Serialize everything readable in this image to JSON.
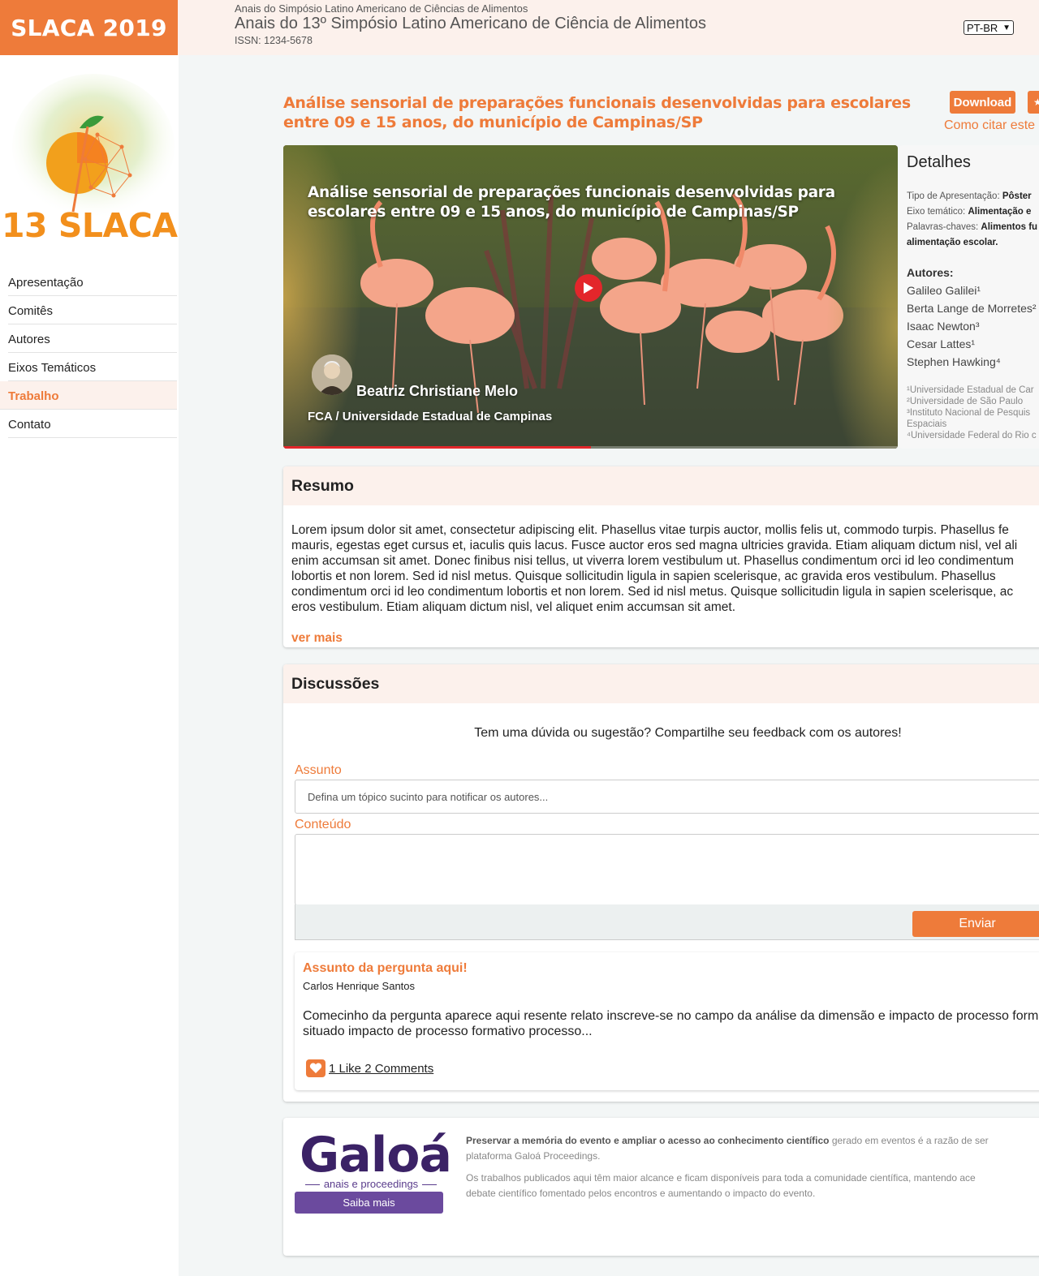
{
  "header": {
    "brand": "SLACA 2019",
    "subtitle": "Anais do Simpósio Latino Americano de Ciências de Alimentos",
    "title": "Anais do 13º Simpósio Latino Americano de Ciência de Alimentos",
    "issn": "ISSN: 1234-5678",
    "language": "PT-BR"
  },
  "sidebar": {
    "logo_text": "13 SLACA",
    "items": [
      {
        "label": "Apresentação"
      },
      {
        "label": "Comitês"
      },
      {
        "label": "Autores"
      },
      {
        "label": "Eixos Temáticos"
      },
      {
        "label": "Trabalho",
        "active": true
      },
      {
        "label": "Contato"
      }
    ]
  },
  "work": {
    "title": "Análise sensorial de preparações funcionais desenvolvidas para escolares entre 09 e 15 anos, do município de Campinas/SP",
    "download_label": "Download",
    "cite_label": "Como citar este"
  },
  "video": {
    "title": "Análise sensorial de preparações funcionais desenvolvidas para escolares entre 09 e 15 anos, do município de Campinas/SP",
    "presenter": "Beatriz Christiane Melo",
    "affiliation": "FCA / Universidade Estadual de Campinas",
    "progress": 0.5
  },
  "details": {
    "heading": "Detalhes",
    "type_label": "Tipo de Apresentação:",
    "type_value": "Pôster",
    "axis_label": "Eixo temático:",
    "axis_value": "Alimentação e",
    "keywords_label": "Palavras-chaves:",
    "keywords_value": "Alimentos fu",
    "keywords_cont": "alimentação escolar.",
    "authors_heading": "Autores:",
    "authors": [
      "Galileo Galilei¹",
      "Berta Lange de Morretes²",
      "Isaac Newton³",
      "Cesar Lattes¹",
      "Stephen Hawking⁴"
    ],
    "affiliations": [
      "¹Universidade Estadual de Car",
      "²Universidade de São Paulo",
      "³Instituto Nacional de Pesquis",
      "Espaciais",
      "⁴Universidade Federal do Rio c"
    ]
  },
  "abstract": {
    "heading": "Resumo",
    "lines": [
      "Lorem ipsum dolor sit amet, consectetur adipiscing elit. Phasellus vitae turpis auctor, mollis felis ut, commodo turpis. Phasellus fe",
      "mauris, egestas eget cursus et, iaculis quis lacus. Fusce auctor eros sed magna ultricies gravida. Etiam aliquam dictum nisl, vel ali",
      "enim accumsan sit amet. Donec finibus nisi tellus, ut viverra lorem vestibulum ut. Phasellus condimentum orci id leo condimentum",
      "lobortis et non lorem. Sed id nisl metus. Quisque sollicitudin ligula in sapien scelerisque, ac gravida eros vestibulum. Phasellus",
      "condimentum orci id leo condimentum lobortis et non lorem. Sed id nisl metus. Quisque sollicitudin ligula in sapien scelerisque, ac",
      "eros vestibulum. Etiam aliquam dictum nisl, vel aliquet enim accumsan sit amet."
    ],
    "more_label": "ver mais"
  },
  "discussion": {
    "heading": "Discussões",
    "prompt": "Tem uma dúvida ou sugestão? Compartilhe seu feedback com os autores!",
    "subject_label": "Assunto",
    "subject_placeholder": "Defina um tópico sucinto para notificar os autores...",
    "content_label": "Conteúdo",
    "send_label": "Enviar",
    "question": {
      "title": "Assunto da pergunta aqui!",
      "author": "Carlos Henrique Santos",
      "body_lines": [
        "Comecinho da pergunta aparece aqui resente relato inscreve-se no campo da análise da dimensão e impacto de processo forma",
        "situado impacto de processo formativo processo..."
      ],
      "meta": "1 Like 2 Comments"
    }
  },
  "galoa": {
    "logo": "Galoá",
    "tagline": "anais e proceedings",
    "button_label": "Saiba mais",
    "p1_bold": "Preservar a memória do evento e ampliar o acesso ao conhecimento científico",
    "p1_rest": " gerado em eventos é a razão de ser",
    "p1_line2": "plataforma Galoá Proceedings.",
    "p2_line1": "Os trabalhos publicados aqui têm maior alcance e ficam disponíveis para toda a comunidade científica, mantendo ace",
    "p2_line2": "debate científico fomentado pelos encontros e aumentando o impacto do evento."
  },
  "colors": {
    "accent": "#ee7b3a",
    "header_bg": "#fcf1ec",
    "page_bg": "#f3f6f6",
    "galoa_purple": "#3b2266"
  }
}
